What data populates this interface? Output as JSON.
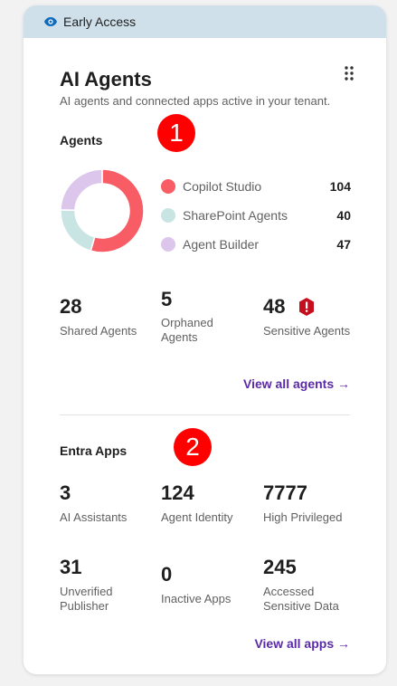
{
  "banner": {
    "label": "Early Access",
    "icon": "eye-icon"
  },
  "header": {
    "title": "AI Agents",
    "subtitle": "AI agents and connected apps active in your tenant.",
    "menu_icon": "drag-dots-icon"
  },
  "agents": {
    "section_title": "Agents",
    "marker": "1",
    "legend": [
      {
        "label": "Copilot Studio",
        "value": "104",
        "color": "#f85c64"
      },
      {
        "label": "SharePoint Agents",
        "value": "40",
        "color": "#c8e5e4"
      },
      {
        "label": "Agent Builder",
        "value": "47",
        "color": "#dcc6ec"
      }
    ],
    "stats": [
      {
        "value": "28",
        "label": "Shared Agents"
      },
      {
        "value": "5",
        "label": "Orphaned Agents"
      },
      {
        "value": "48",
        "label": "Sensitive Agents",
        "icon": "warning-icon"
      }
    ],
    "link": "View all agents →"
  },
  "entra": {
    "section_title": "Entra Apps",
    "marker": "2",
    "stats": [
      {
        "value": "3",
        "label": "AI Assistants"
      },
      {
        "value": "124",
        "label": "Agent Identity"
      },
      {
        "value": "7777",
        "label": "High Privileged"
      },
      {
        "value": "31",
        "label": "Unverified Publisher"
      },
      {
        "value": "0",
        "label": "Inactive Apps"
      },
      {
        "value": "245",
        "label": "Accessed Sensitive Data"
      }
    ],
    "link": "View all apps →"
  }
}
